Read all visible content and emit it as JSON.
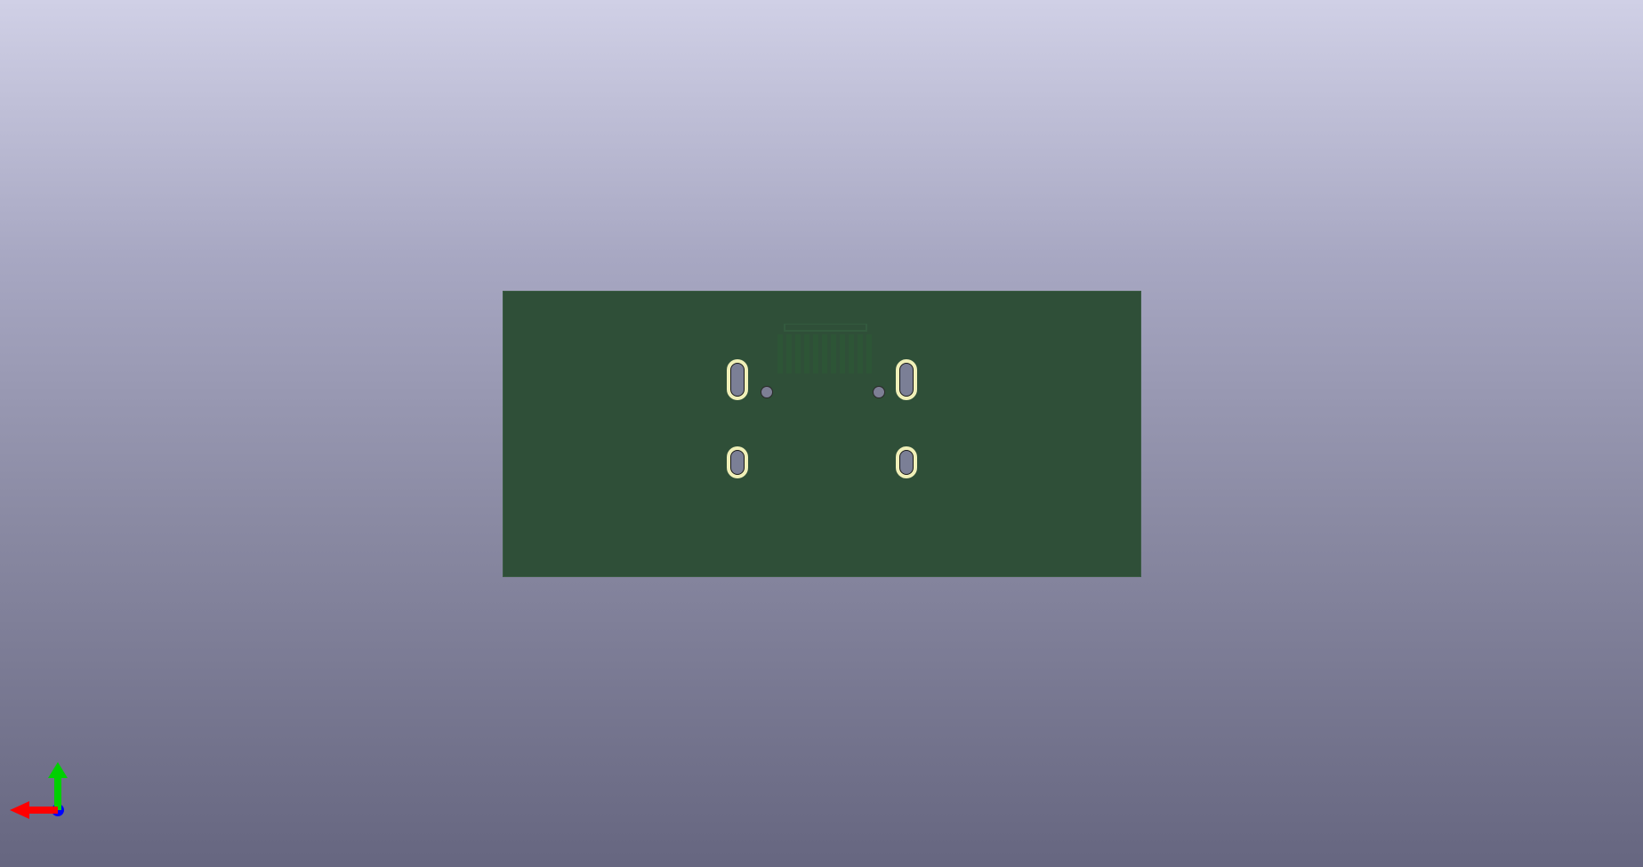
{
  "viewer": {
    "background_top": "#d0d0e6",
    "background_bottom": "#666680"
  },
  "board": {
    "color": "#2f4f38",
    "pad_color": "#f0f0b8",
    "drill_color": "#7b7f96"
  },
  "axes": {
    "x_color": "#ff0000",
    "y_color": "#00d000",
    "z_color": "#0000ff"
  }
}
